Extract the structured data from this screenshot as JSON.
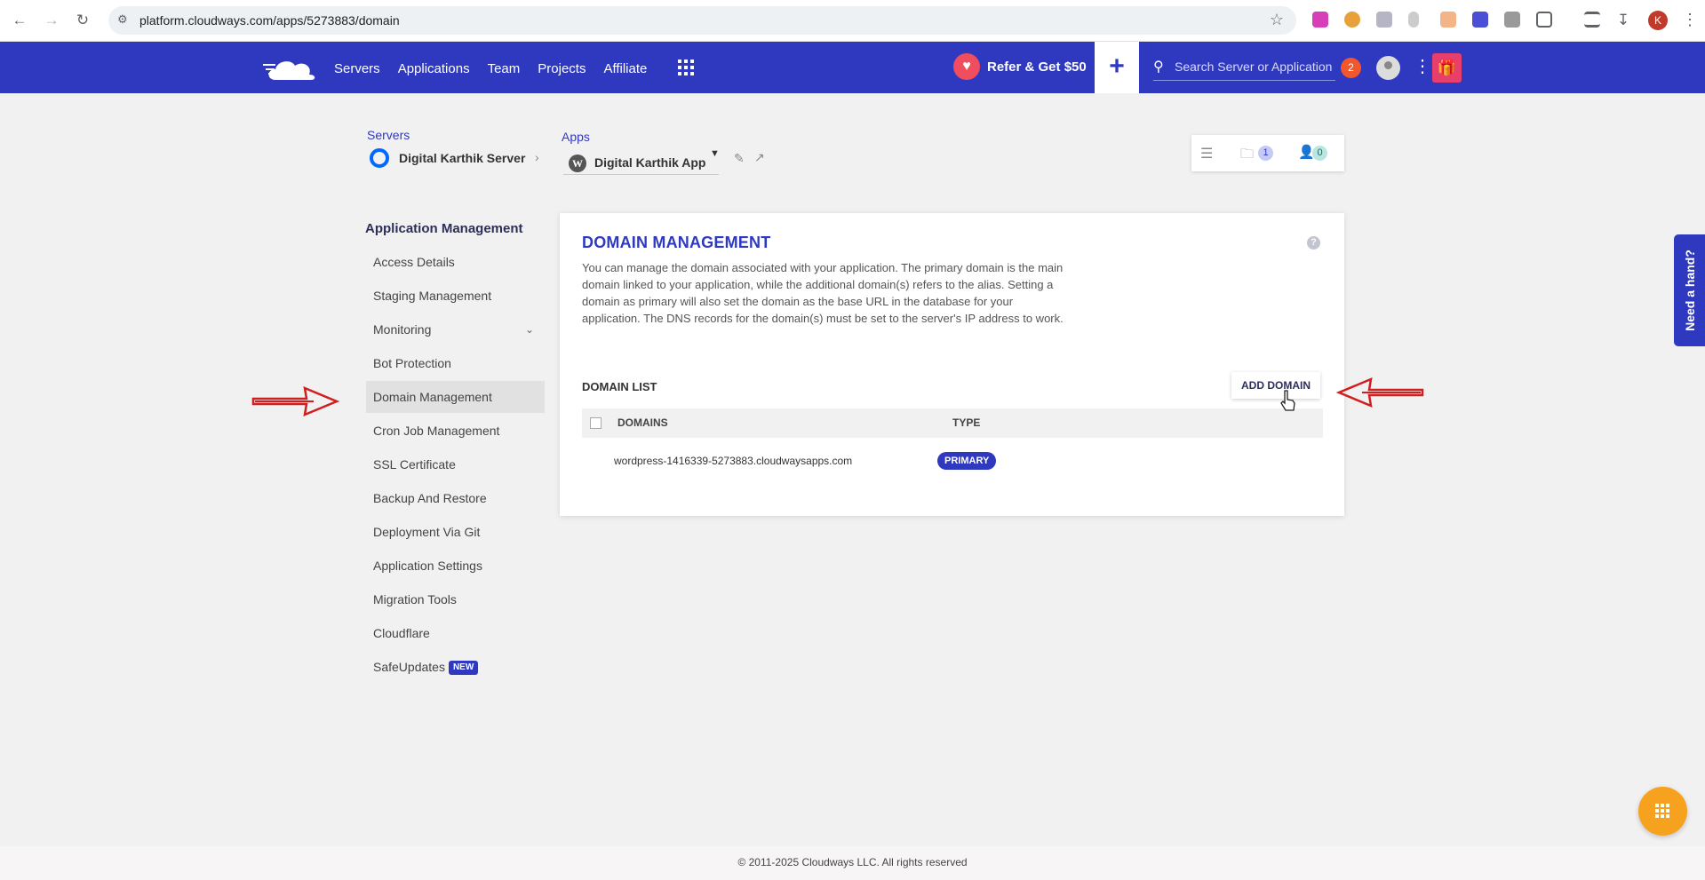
{
  "browser": {
    "url": "platform.cloudways.com/apps/5273883/domain",
    "profile_initial": "K"
  },
  "header": {
    "nav": [
      "Servers",
      "Applications",
      "Team",
      "Projects",
      "Affiliate"
    ],
    "refer_label": "Refer & Get $50",
    "search_placeholder": "Search Server or Application",
    "notification_count": "2",
    "brand_color": "#2f39bf"
  },
  "breadcrumb": {
    "servers_label": "Servers",
    "server_name": "Digital Karthik Server",
    "apps_label": "Apps",
    "app_name": "Digital Karthik App"
  },
  "stats": {
    "folders_count": "1",
    "members_count": "0"
  },
  "sidebar": {
    "title": "Application Management",
    "items": [
      {
        "label": "Access Details"
      },
      {
        "label": "Staging Management"
      },
      {
        "label": "Monitoring"
      },
      {
        "label": "Bot Protection"
      },
      {
        "label": "Domain Management"
      },
      {
        "label": "Cron Job Management"
      },
      {
        "label": "SSL Certificate"
      },
      {
        "label": "Backup And Restore"
      },
      {
        "label": "Deployment Via Git"
      },
      {
        "label": "Application Settings"
      },
      {
        "label": "Migration Tools"
      },
      {
        "label": "Cloudflare"
      },
      {
        "label": "SafeUpdates",
        "badge": "NEW"
      }
    ],
    "active_item": "Domain Management"
  },
  "main": {
    "title": "DOMAIN MANAGEMENT",
    "description": "You can manage the domain associated with your application. The primary domain is the main domain linked to your application, while the additional domain(s) refers to the alias. Setting a domain as primary will also set the domain as the base URL in the database for your application. The DNS records for the domain(s) must be set to the server's IP address to work.",
    "list_title": "DOMAIN LIST",
    "add_button": "ADD DOMAIN",
    "columns": [
      "DOMAINS",
      "TYPE"
    ],
    "rows": [
      {
        "domain": "wordpress-1416339-5273883.cloudwaysapps.com",
        "type": "PRIMARY"
      }
    ]
  },
  "help_tab": "Need a hand?",
  "footer": "© 2011-2025 Cloudways LLC. All rights reserved"
}
